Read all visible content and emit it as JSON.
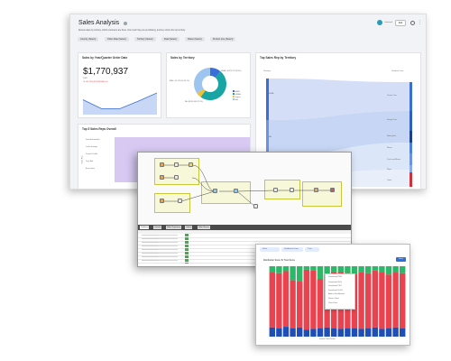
{
  "dashboard": {
    "title": "Sales Analysis",
    "subtitle": "Review sales by territory, which customers are there, how much they are purchasing, and key victors the top territory.",
    "filters": [
      "Country (Select)",
      "Order Date (Select)",
      "Territory (Select)",
      "Deal (Select)",
      "Status (Select)",
      "Product Line (Select)"
    ],
    "header_buttons": {
      "user": "Lakeland",
      "edit": "Edit"
    },
    "cards": {
      "order_date": {
        "title": "Sales by Year/Quarter Order Date",
        "value": "$1,770,937",
        "unit": "2005",
        "delta": "▼ -60.75% ($1,529,590) Q4",
        "series": [
          0.55,
          0.22,
          0.22,
          0.5,
          0.8
        ]
      },
      "territory": {
        "title": "Sales by Territory",
        "legend": [
          "APAC",
          "EMEA",
          "Japan",
          "NA"
        ],
        "colors": [
          "#3b6fd8",
          "#1aa5a5",
          "#f2c12e",
          "#9ec5f0"
        ],
        "slices": [
          0.11,
          0.49,
          0.05,
          0.35
        ],
        "labels": [
          "EMEA - $4,979,272 (49.6%)",
          "NA - $3,852,061 (37.8%)",
          "APAC - $1,297,054 (11.1%)"
        ]
      },
      "sankey": {
        "title": "Top Sales Rep by Territory",
        "left_header": "Territory",
        "right_header": "Products Line",
        "left_nodes": [
          "EMEA",
          "NA",
          "APAC",
          "Japan"
        ],
        "right_nodes": [
          "Classic Cars",
          "Vintage Cars",
          "Motorcycles",
          "Planes",
          "Trucks and Buses",
          "Ships",
          "Trains"
        ]
      },
      "reps": {
        "title": "Top 5 Sales Reps Overall",
        "ylabel": "Sales Rep",
        "rows": [
          "Gerard Hernandez",
          "Leslie Jennings",
          "Pamela Castillo",
          "Larry Bott",
          "Barry Jones"
        ]
      }
    }
  },
  "workflow": {
    "tabs": [
      "Problems",
      "Console",
      "Node Repository",
      "Outline",
      "Node Monitor"
    ]
  },
  "stacked_chart": {
    "title": "Distribution Score To Trust Score",
    "xlabel": "Sorted Count Name",
    "filters": [
      "Value Configuration",
      "Distribution Score",
      "Trust Score"
    ],
    "button": "Save",
    "menu": [
      "Download PNG",
      "Download SVG",
      "Download CSV",
      "Download XLSX",
      "Add to Dashboard",
      "Share Chart",
      "View Data"
    ],
    "chart_data": {
      "type": "bar",
      "stacked": true,
      "colors": [
        "#1f4fb4",
        "#e8434f",
        "#2db768"
      ],
      "bars": 20,
      "blue": [
        0.13,
        0.12,
        0.14,
        0.12,
        0.13,
        0.1,
        0.11,
        0.12,
        0.13,
        0.12,
        0.11,
        0.12,
        0.12,
        0.11,
        0.12,
        0.13,
        0.11,
        0.12,
        0.13,
        0.12
      ],
      "green": [
        0.09,
        0.1,
        0.07,
        0.2,
        0.21,
        0.05,
        0.06,
        0.18,
        0.12,
        0.08,
        0.09,
        0.1,
        0.11,
        0.08,
        0.1,
        0.06,
        0.09,
        0.12,
        0.09,
        0.1
      ]
    }
  }
}
